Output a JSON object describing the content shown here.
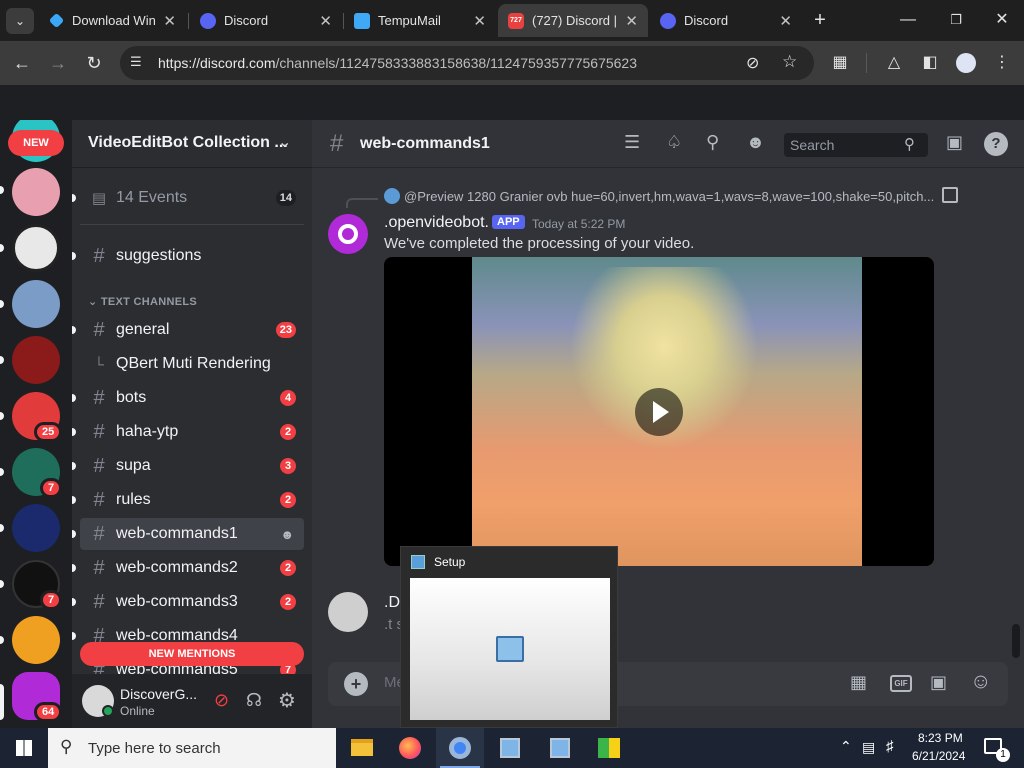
{
  "browser": {
    "tabs": [
      {
        "label": "Download Win",
        "icon": "download-icon",
        "color": "#3ba7f7"
      },
      {
        "label": "Discord",
        "icon": "discord-icon",
        "color": "#5865f2"
      },
      {
        "label": "TempuMail",
        "icon": "mail-icon",
        "color": "#3fa9f5"
      },
      {
        "label": "(727) Discord |",
        "icon": "discord-badge-icon",
        "color": "#e94040",
        "badge": "727",
        "active": true
      },
      {
        "label": "Discord",
        "icon": "discord-icon",
        "color": "#5865f2"
      }
    ],
    "new_tab": "+",
    "url_host": "https://discord.com",
    "url_path": "/channels/1124758333883158638/1124759357775675623"
  },
  "rail": {
    "new_label": "NEW",
    "servers": [
      {
        "name": "anime-server",
        "color": "#e8a0b0"
      },
      {
        "name": "cool-face-server",
        "color": "#eeeeee"
      },
      {
        "name": "shred-server",
        "color": "#7a9cc6"
      },
      {
        "name": "dark-red-server",
        "color": "#8b1a1a"
      },
      {
        "name": "red-logo-server",
        "color": "#e23b3b",
        "badge": "25"
      },
      {
        "name": "green-play-server",
        "color": "#1f6e5c",
        "badge": "7"
      },
      {
        "name": "mask-server",
        "color": "#1a2a6c"
      },
      {
        "name": "po-server",
        "color": "#111111",
        "badge": "7"
      },
      {
        "name": "bolt-server",
        "color": "#f0a020"
      },
      {
        "name": "videoeditbot-server",
        "color": "#b02ad8",
        "badge": "64"
      }
    ]
  },
  "sidebar": {
    "server_name": "VideoEditBot Collection ...",
    "events_label": "14 Events",
    "events_count": "14",
    "category": "TEXT CHANNELS",
    "new_mentions": "NEW MENTIONS",
    "channels": [
      {
        "name": "suggestions",
        "count": ""
      },
      {
        "name": "general",
        "count": "23"
      },
      {
        "name": "QBert Muti Rendering",
        "count": "",
        "thread": true
      },
      {
        "name": "bots",
        "count": "4"
      },
      {
        "name": "haha-ytp",
        "count": "2"
      },
      {
        "name": "supa",
        "count": "3"
      },
      {
        "name": "rules",
        "count": "2"
      },
      {
        "name": "web-commands1",
        "count": "",
        "selected": true
      },
      {
        "name": "web-commands2",
        "count": "2"
      },
      {
        "name": "web-commands3",
        "count": "2"
      },
      {
        "name": "web-commands4",
        "count": ""
      },
      {
        "name": "web-commands5",
        "count": "7"
      }
    ]
  },
  "user": {
    "name": "DiscoverG...",
    "status": "Online"
  },
  "header": {
    "channel": "web-commands1",
    "search_placeholder": "Search"
  },
  "message": {
    "reply_preview": "@Preview 1280 Granier ovb hue=60,invert,hm,wava=1,wavs=8,wave=100,shake=50,pitch...",
    "author": ".openvideobot.",
    "tag": "APP",
    "time": "Today at 5:22 PM",
    "text": "We've completed the processing of your video."
  },
  "message2": {
    "author": ".DC",
    "text": ".t s"
  },
  "composer": {
    "placeholder": "Me"
  },
  "setup_window": {
    "title": "Setup"
  },
  "taskbar": {
    "search_placeholder": "Type here to search",
    "time": "8:23 PM",
    "date": "6/21/2024",
    "notification_count": "1"
  }
}
